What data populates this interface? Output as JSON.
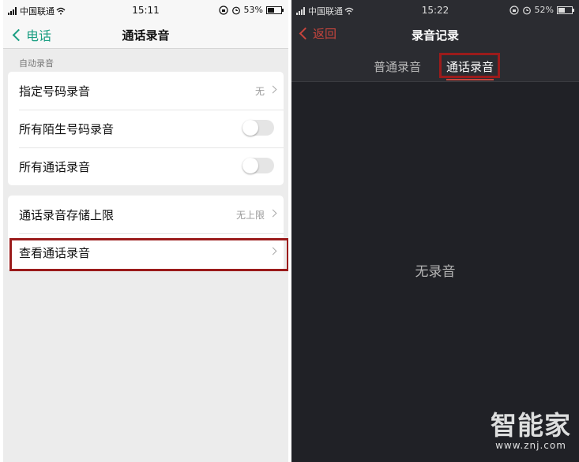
{
  "left": {
    "status": {
      "carrier": "中国联通",
      "time": "15:11",
      "battery": "53%",
      "battery_level": 0.53
    },
    "nav": {
      "back_label": "电话",
      "title": "通话录音"
    },
    "section_label": "自动录音",
    "group1": [
      {
        "label": "指定号码录音",
        "value": "无"
      },
      {
        "label": "所有陌生号码录音",
        "toggle": "off"
      },
      {
        "label": "所有通话录音",
        "toggle": "off"
      }
    ],
    "group2": [
      {
        "label": "通话录音存储上限",
        "value": "无上限"
      },
      {
        "label": "查看通话录音",
        "highlighted": true
      }
    ]
  },
  "right": {
    "status": {
      "carrier": "中国联通",
      "time": "15:22",
      "battery": "52%",
      "battery_level": 0.52
    },
    "nav": {
      "back_label": "返回",
      "title": "录音记录"
    },
    "tabs": [
      {
        "label": "普通录音",
        "active": false
      },
      {
        "label": "通话录音",
        "active": true
      }
    ],
    "empty_text": "无录音"
  },
  "watermark": {
    "brand": "智能家",
    "url": "www.znj.com"
  },
  "colors": {
    "accent_green": "#1a9e82",
    "accent_red": "#c8453d",
    "highlight_box": "#9b1b1b"
  },
  "icons": [
    "signal-icon",
    "wifi-icon",
    "alarm-icon",
    "clock-icon",
    "battery-icon",
    "back-chevron-icon",
    "chevron-right-icon"
  ]
}
